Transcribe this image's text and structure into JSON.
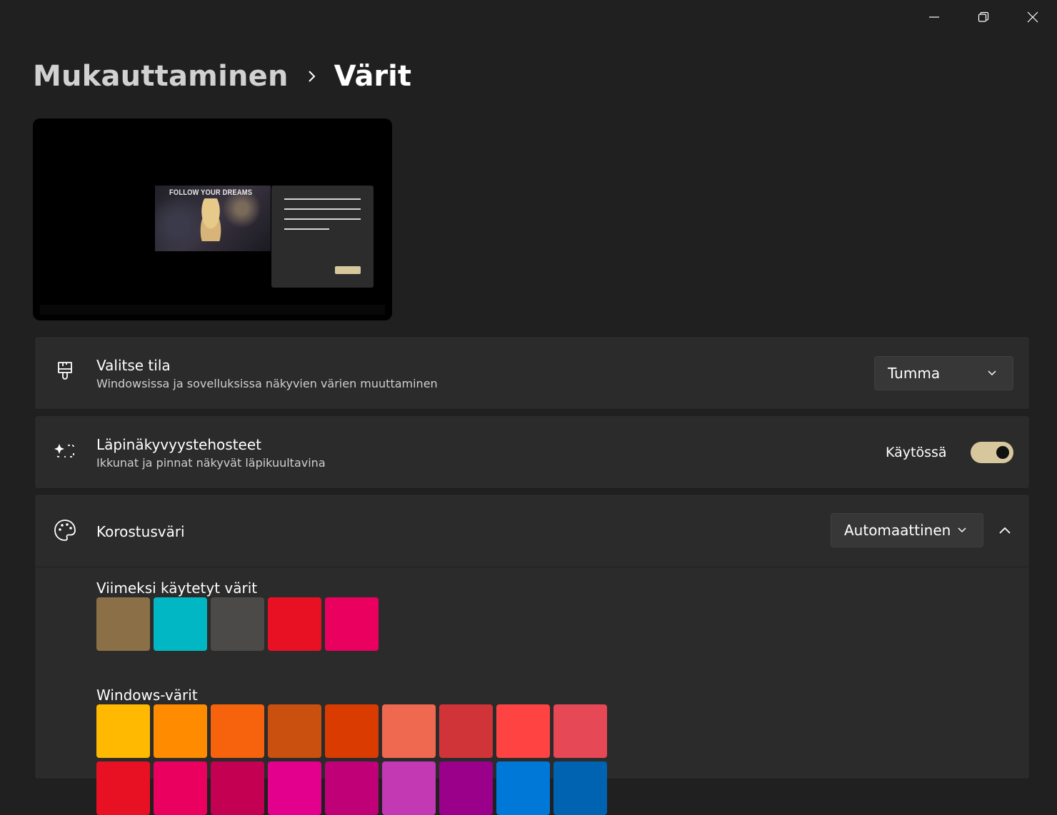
{
  "window_controls": {
    "minimize_icon": "minimize-icon",
    "maximize_icon": "restore-icon",
    "close_icon": "close-icon"
  },
  "breadcrumb": {
    "parent": "Mukauttaminen",
    "separator_icon": "chevron-right-icon",
    "current": "Värit"
  },
  "preview": {
    "wallpaper_caption": "FOLLOW YOUR DREAMS",
    "accent_color": "#d6c79d"
  },
  "mode_card": {
    "icon": "paintbrush-icon",
    "title": "Valitse tila",
    "subtitle": "Windowsissa ja sovelluksissa näkyvien värien muuttaminen",
    "dropdown_value": "Tumma"
  },
  "transparency_card": {
    "icon": "transparency-sparkle-icon",
    "title": "Läpinäkyvyystehosteet",
    "subtitle": "Ikkunat ja pinnat näkyvät läpikuultavina",
    "toggle_label": "Käytössä",
    "toggle_on": true
  },
  "accent_card": {
    "icon": "palette-icon",
    "title": "Korostusväri",
    "dropdown_value": "Automaattinen",
    "expanded": true,
    "recent_label": "Viimeksi käytetyt värit",
    "recent_colors": [
      "#8b6f47",
      "#00b7c3",
      "#4c4a48",
      "#e81123",
      "#ea005e"
    ],
    "windows_label": "Windows-värit",
    "windows_colors_row1": [
      "#ffb900",
      "#ff8c00",
      "#f7630c",
      "#ca5010",
      "#da3b01",
      "#ef6950",
      "#d13438",
      "#ff4343",
      "#e74856"
    ],
    "windows_colors_row2": [
      "#e81123",
      "#ea005e",
      "#c30052",
      "#e3008c",
      "#bf0077",
      "#c239b3",
      "#9a0089",
      "#0078d7",
      "#0063b1"
    ]
  }
}
